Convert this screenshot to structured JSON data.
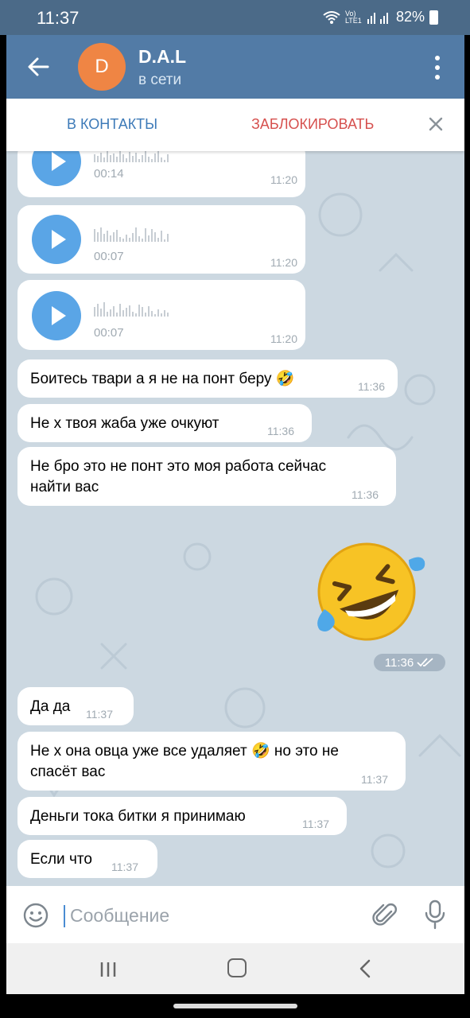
{
  "status_bar": {
    "time": "11:37",
    "signal_text": "Vo) LTE1",
    "battery": "82%"
  },
  "header": {
    "avatar_letter": "D",
    "avatar_color": "#ef8544",
    "name": "D.A.L",
    "status": "в сети"
  },
  "action_bar": {
    "add_contact": "В КОНТАКТЫ",
    "block": "ЗАБЛОКИРОВАТЬ"
  },
  "voice_messages": [
    {
      "duration": "00:14",
      "time": "11:20"
    },
    {
      "duration": "00:07",
      "time": "11:20"
    },
    {
      "duration": "00:07",
      "time": "11:20"
    }
  ],
  "messages_before_sticker": [
    {
      "line1": "Боитесь твари а я не на понт беру 🤣",
      "line2": "",
      "time": "11:36"
    },
    {
      "line1": "Не х твоя жаба уже очкуют",
      "line2": "",
      "time": "11:36"
    },
    {
      "line1": "Не бро это не понт это моя работа сейчас",
      "line2": "найти вас",
      "time": "11:36"
    }
  ],
  "sticker": {
    "emoji": "rolling-on-floor-laughing",
    "time": "11:36",
    "read": true
  },
  "messages_after_sticker": [
    {
      "line1": "Да да",
      "line2": "",
      "time": "11:37"
    },
    {
      "line1": "Не х она овца уже все удаляет 🤣 но это не",
      "line2": "спасёт вас",
      "time": "11:37"
    },
    {
      "line1": "Деньги тока битки я принимаю",
      "line2": "",
      "time": "11:37"
    },
    {
      "line1": "Если что",
      "line2": "",
      "time": "11:37"
    }
  ],
  "composer": {
    "placeholder": "Сообщение"
  },
  "colors": {
    "header": "#527ba6",
    "status_bar": "#4b6a88",
    "chat_bg": "#ccd8e1",
    "accent_blue": "#3d7ab8",
    "block_red": "#d6504e",
    "play_button": "#5aa5e6"
  }
}
